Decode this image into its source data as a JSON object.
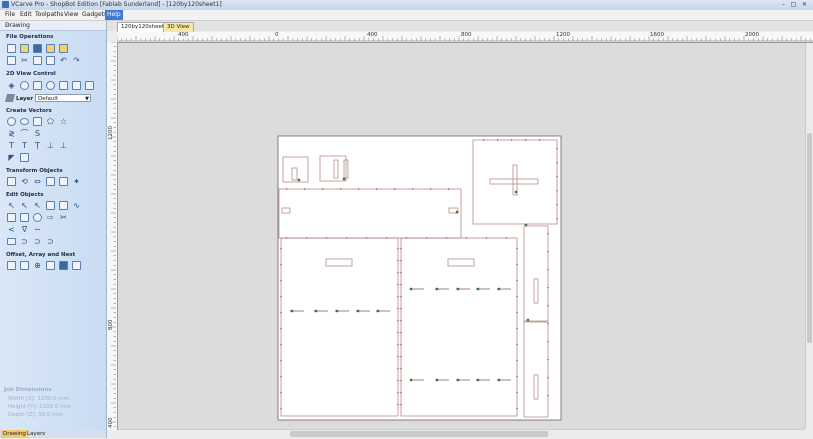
{
  "window": {
    "title": "VCarve Pro - ShopBot Edition [Fablab Sunderland] - [120by120sheet1]"
  },
  "menu": {
    "items": [
      "File",
      "Edit",
      "Toolpaths",
      "View",
      "Gadgets",
      "Help"
    ],
    "active": "Help"
  },
  "sidebar": {
    "header": "Drawing",
    "sections": {
      "file_operations": "File Operations",
      "view_control": "2D View Control",
      "create_vectors": "Create Vectors",
      "transform": "Transform Objects",
      "edit_objects": "Edit Objects",
      "offset_array": "Offset, Array and Nest"
    },
    "layer_label": "Layer",
    "layer_value": "Default",
    "job_dimensions": {
      "title": "Job Dimensions",
      "width": "Width  [X]: 1200.0 mm",
      "height": "Height [Y]: 1200.0 mm",
      "depth": "Depth  [Z]: 30.0 mm"
    },
    "tabs": [
      "Drawing",
      "Layers"
    ]
  },
  "document_tabs": [
    "120by120sheet1",
    "3D View"
  ],
  "ruler": {
    "h_labels": [
      "400",
      "0",
      "400",
      "800",
      "1200",
      "1600",
      "2000"
    ],
    "v_labels": [
      "1200",
      "800",
      "400"
    ]
  },
  "colors": {
    "accent": "#3b7bd4",
    "sidebar": "#c9dcf2",
    "active_tab": "#f3c96b",
    "vector": "#b07a7a",
    "node": "#2e7d32"
  }
}
